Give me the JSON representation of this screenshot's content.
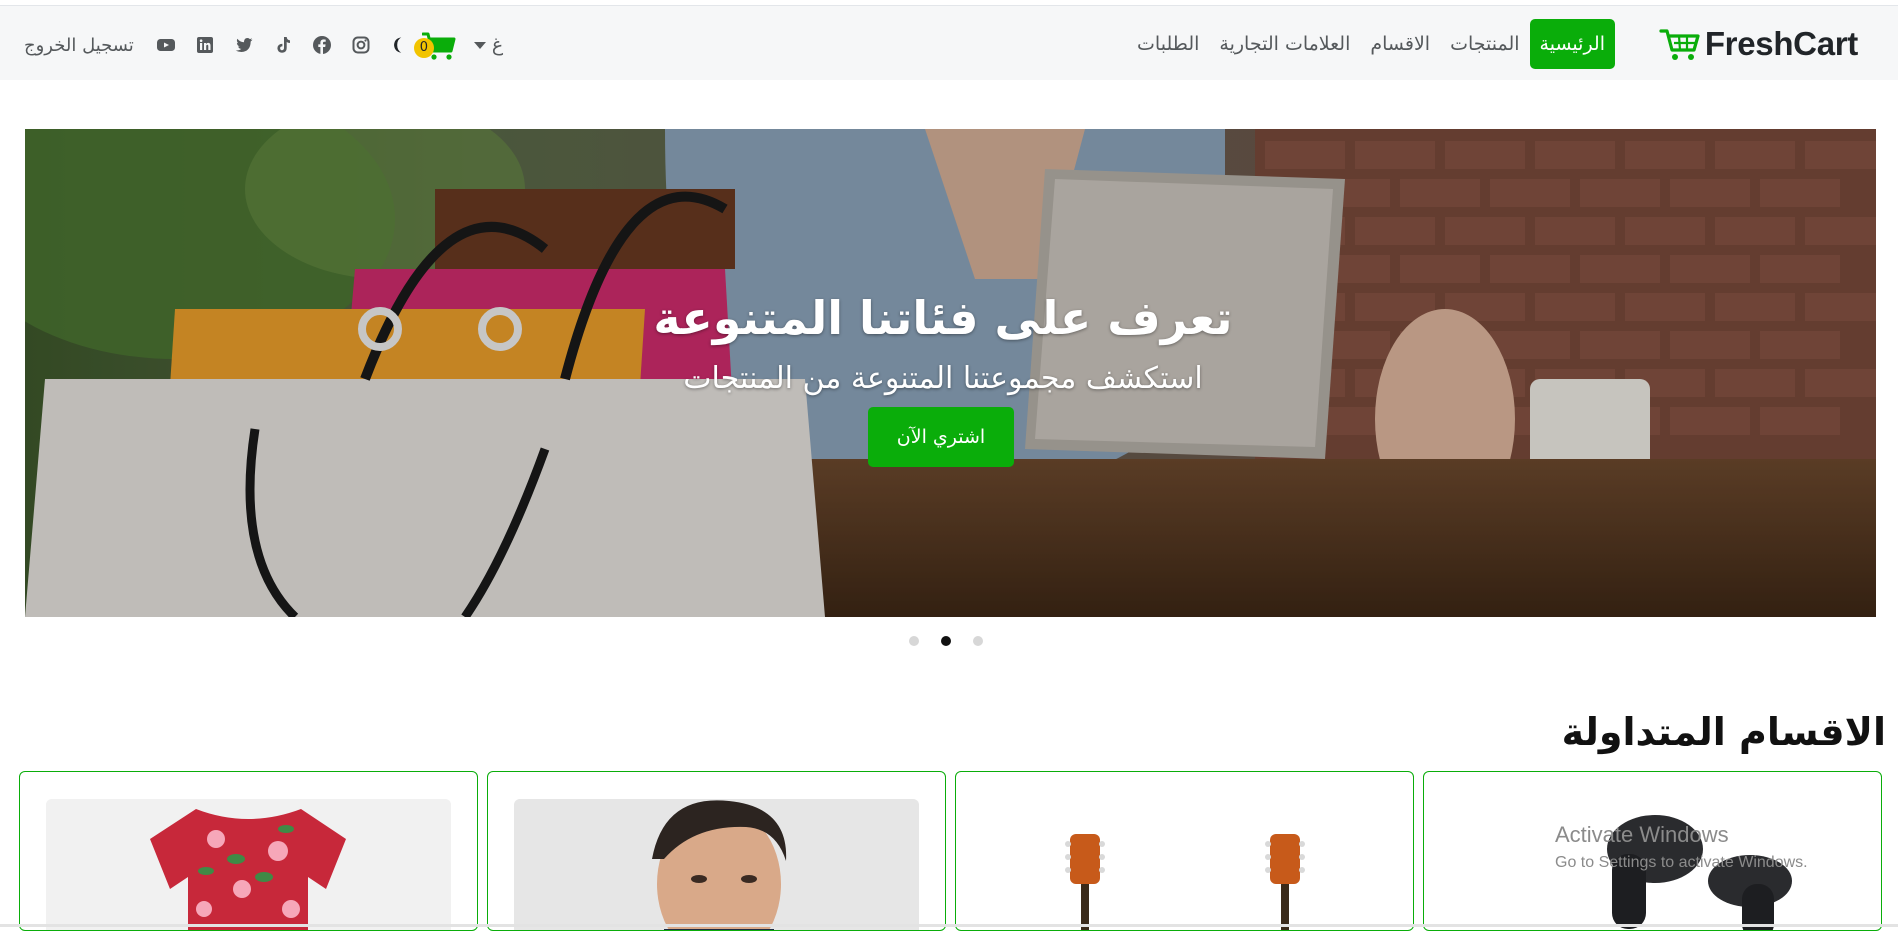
{
  "brand": {
    "name": "FreshCart",
    "accent": "#0aad0a"
  },
  "nav": {
    "links": [
      {
        "label": "الرئيسية",
        "active": true
      },
      {
        "label": "المنتجات",
        "active": false
      },
      {
        "label": "الاقسام",
        "active": false
      },
      {
        "label": "العلامات التجارية",
        "active": false
      },
      {
        "label": "الطلبات",
        "active": false
      }
    ],
    "language_label": "غ",
    "cart_count": "0",
    "logout_label": "تسجيل الخروج",
    "icons": [
      "cart-icon",
      "moon-icon",
      "instagram-icon",
      "facebook-icon",
      "tiktok-icon",
      "twitter-icon",
      "linkedin-icon",
      "youtube-icon"
    ]
  },
  "hero": {
    "title": "تعرف على فئاتنا المتنوعة",
    "subtitle": "استكشف مجموعتنا المتنوعة من المنتجات",
    "cta_label": "اشتري الآن",
    "slides_count": 3,
    "active_slide": 2
  },
  "trending": {
    "title": "الاقسام المتداولة",
    "cards": [
      {
        "image": "earbuds"
      },
      {
        "image": "guitars"
      },
      {
        "image": "man-portrait"
      },
      {
        "image": "floral-dress"
      }
    ]
  },
  "watermark": {
    "line1": "Activate Windows",
    "line2": "Go to Settings to activate Windows."
  }
}
